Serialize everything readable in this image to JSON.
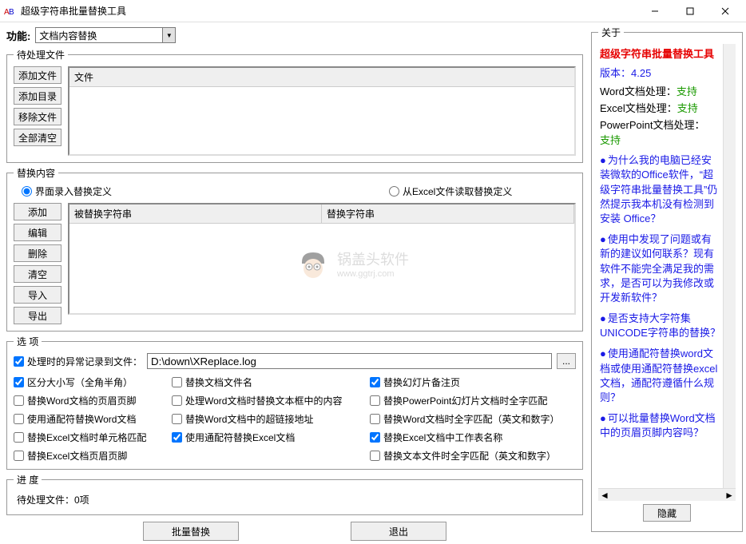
{
  "titlebar": {
    "title": "超级字符串批量替换工具"
  },
  "func": {
    "label": "功能:",
    "selected": "文档内容替换"
  },
  "files": {
    "legend": "待处理文件",
    "btns": {
      "add_file": "添加文件",
      "add_dir": "添加目录",
      "remove": "移除文件",
      "clear": "全部清空"
    },
    "header": "文件"
  },
  "replace": {
    "legend": "替换内容",
    "radio_ui": "界面录入替换定义",
    "radio_excel": "从Excel文件读取替换定义",
    "btns": {
      "add": "添加",
      "edit": "编辑",
      "delete": "删除",
      "clear": "清空",
      "import": "导入",
      "export": "导出"
    },
    "th1": "被替换字符串",
    "th2": "替换字符串"
  },
  "options": {
    "legend": "选 项",
    "log_label": "处理时的异常记录到文件：",
    "log_path": "D:\\down\\XReplace.log",
    "checks": {
      "c1": "区分大小写（全角半角）",
      "c2": "替换文档文件名",
      "c3": "替换幻灯片备注页",
      "c4": "替换Word文档的页眉页脚",
      "c5": "处理Word文档时替换文本框中的内容",
      "c6": "替换PowerPoint幻灯片文档时全字匹配",
      "c7": "使用通配符替换Word文档",
      "c8": "替换Word文档中的超链接地址",
      "c9": "替换Word文档时全字匹配（英文和数字）",
      "c10": "替换Excel文档时单元格匹配",
      "c11": "使用通配符替换Excel文档",
      "c12": "替换Excel文档中工作表名称",
      "c13": "替换Excel文档页眉页脚",
      "c14_empty": "",
      "c15": "替换文本文件时全字匹配（英文和数字）"
    }
  },
  "progress": {
    "legend": "进 度",
    "text": "待处理文件：0项"
  },
  "bottom": {
    "batch": "批量替换",
    "exit": "退出"
  },
  "about": {
    "legend": "关于",
    "title": "超级字符串批量替换工具",
    "version_label": "版本：",
    "version_value": "4.25",
    "word_label": "Word文档处理：",
    "excel_label": "Excel文档处理：",
    "ppt_label": "PowerPoint文档处理：",
    "support": "支持",
    "links": [
      "为什么我的电脑已经安装微软的Office软件，“超级字符串批量替换工具”仍然提示我本机没有检测到安装 Office？",
      "使用中发现了问题或有新的建议如何联系？现有软件不能完全满足我的需求，是否可以为我修改或开发新软件？",
      "是否支持大字符集UNICODE字符串的替换？",
      "使用通配符替换word文档或使用通配符替换excel文档，通配符遵循什么规则？",
      "可以批量替换Word文档中的页眉页脚内容吗？"
    ],
    "hide_btn": "隐藏"
  },
  "watermark": {
    "text": "锅盖头软件",
    "url": "www.ggtrj.com"
  }
}
